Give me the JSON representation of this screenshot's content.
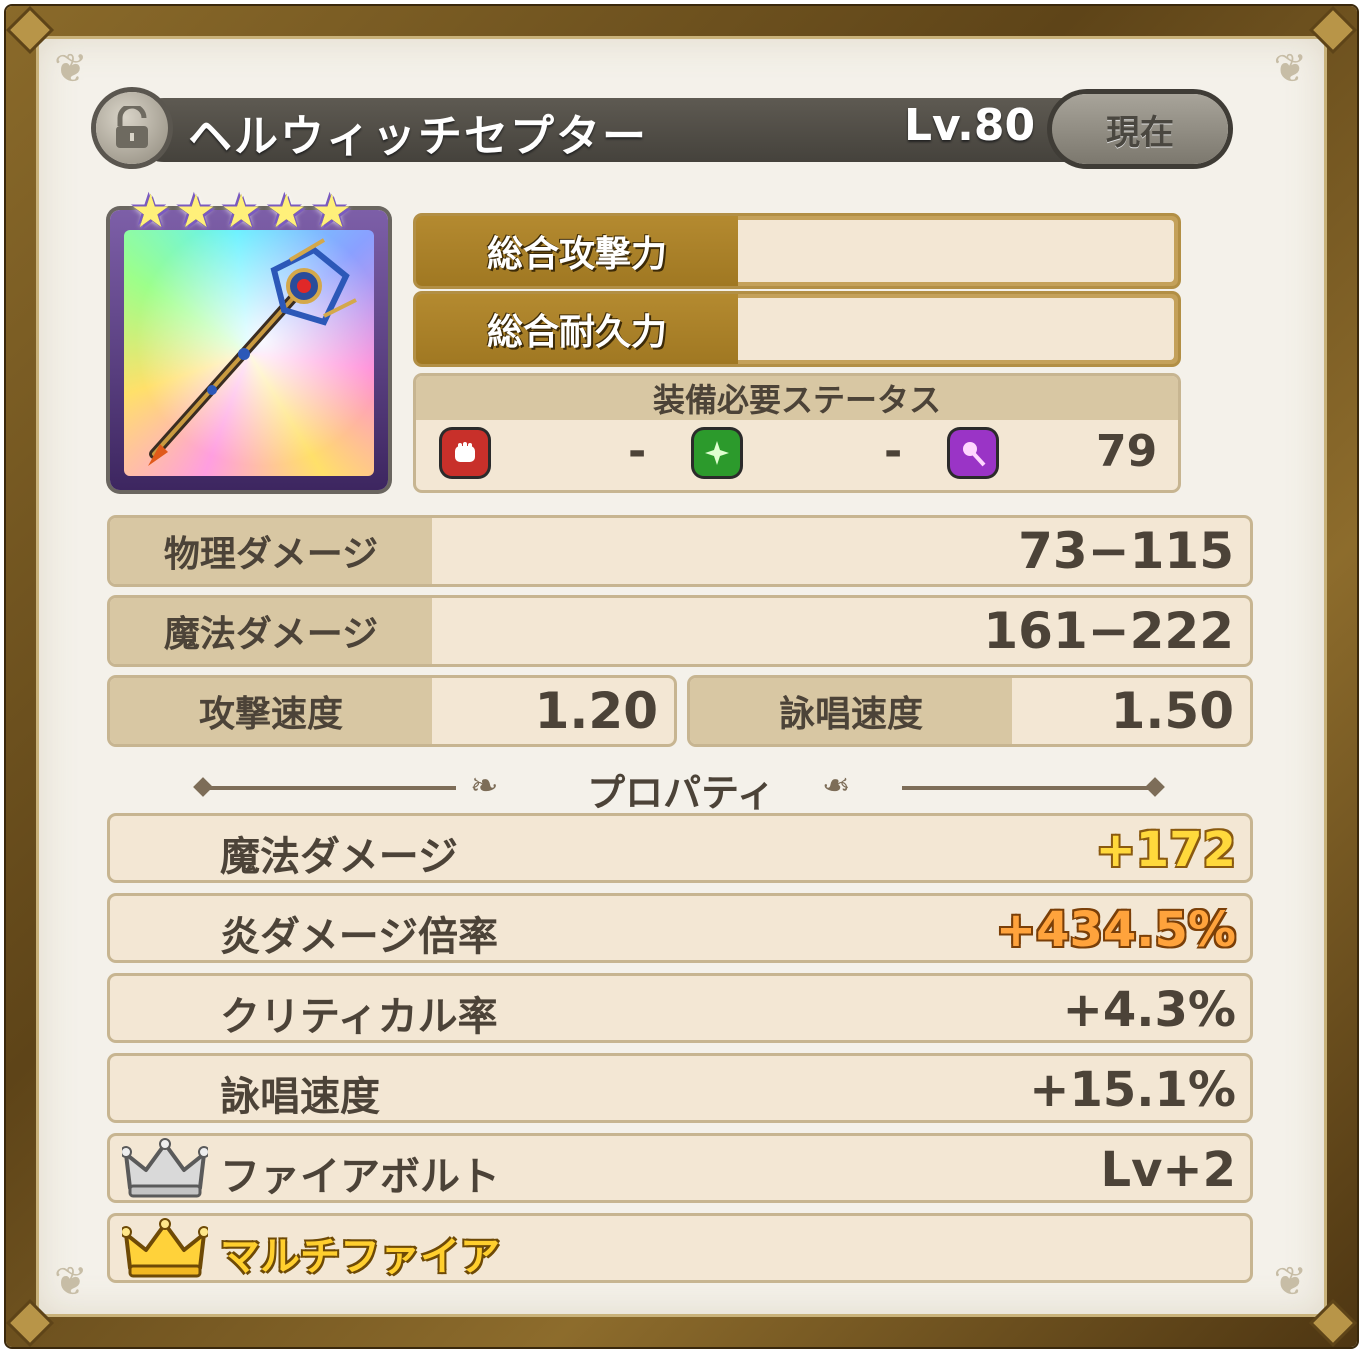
{
  "header": {
    "title": "ヘルウィッチセプター",
    "level": "Lv.80",
    "current_label": "現在",
    "lock_state": "unlocked"
  },
  "item": {
    "stars": 5,
    "icon": "staff-icon"
  },
  "totals": {
    "attack_label": "総合攻撃力",
    "durability_label": "総合耐久力"
  },
  "requirements": {
    "title": "装備必要ステータス",
    "items": [
      {
        "icon": "fist-icon",
        "color": "#c8302a",
        "value": "-"
      },
      {
        "icon": "clover-icon",
        "color": "#2c9a2c",
        "value": "-"
      },
      {
        "icon": "wand-icon",
        "color": "#9a34c6",
        "value": "79"
      }
    ]
  },
  "stats": {
    "physical_damage": {
      "label": "物理ダメージ",
      "value": "73−115"
    },
    "magic_damage": {
      "label": "魔法ダメージ",
      "value": "161−222"
    },
    "attack_speed": {
      "label": "攻撃速度",
      "value": "1.20"
    },
    "cast_speed": {
      "label": "詠唱速度",
      "value": "1.50"
    }
  },
  "properties": {
    "title": "プロパティ",
    "rows": [
      {
        "label": "魔法ダメージ",
        "value": "+172",
        "style": "gold"
      },
      {
        "label": "炎ダメージ倍率",
        "value": "+434.5%",
        "style": "orange"
      },
      {
        "label": "クリティカル率",
        "value": "+4.3%",
        "style": "normal"
      },
      {
        "label": "詠唱速度",
        "value": "+15.1%",
        "style": "normal"
      },
      {
        "label": "ファイアボルト",
        "value": "Lv+2",
        "style": "normal",
        "crown": "silver-crown-icon"
      },
      {
        "label": "マルチファイア",
        "value": "",
        "style": "skill-gold",
        "crown": "gold-crown-icon"
      }
    ]
  },
  "colors": {
    "frame": "#6e5220",
    "panel": "#f4f1ea",
    "label_bg": "#d8c7a3",
    "value_bg": "#f3e7d4",
    "gold_bar": "#b48a30",
    "text": "#4c4338"
  }
}
